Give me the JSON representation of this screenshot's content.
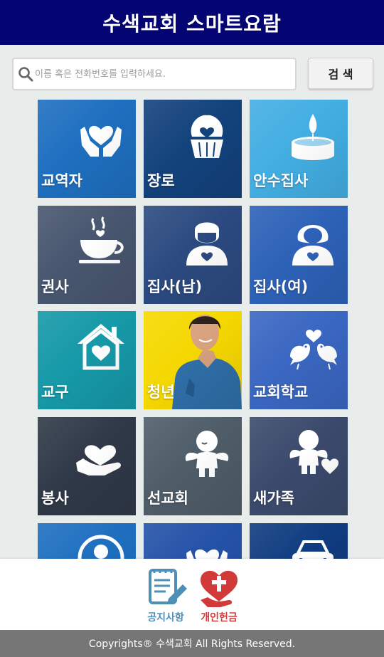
{
  "header": {
    "title": "수색교회 스마트요람"
  },
  "search": {
    "placeholder": "이름 혹은 전화번호를 입력하세요.",
    "button_label": "검 색"
  },
  "tiles": [
    {
      "label": "교역자",
      "icon": "hands-heart-icon",
      "color": "#1e6fc0"
    },
    {
      "label": "장로",
      "icon": "cupcake-heart-icon",
      "color": "#13427c"
    },
    {
      "label": "안수집사",
      "icon": "candle-icon",
      "color": "#43aee3"
    },
    {
      "label": "권사",
      "icon": "coffee-cup-icon",
      "color": "#48566f"
    },
    {
      "label": "집사(남)",
      "icon": "man-heart-icon",
      "color": "#2c4a80"
    },
    {
      "label": "집사(여)",
      "icon": "woman-heart-icon",
      "color": "#2d62b8"
    },
    {
      "label": "교구",
      "icon": "house-heart-icon",
      "color": "#1699a8"
    },
    {
      "label": "청년",
      "icon": "young-man-photo",
      "color": "#f5d800"
    },
    {
      "label": "교회학교",
      "icon": "love-birds-icon",
      "color": "#3a67c2"
    },
    {
      "label": "봉사",
      "icon": "hand-heart-icon",
      "color": "#303948"
    },
    {
      "label": "선교회",
      "icon": "cherub-icon",
      "color": "#4f5d69"
    },
    {
      "label": "새가족",
      "icon": "cherub-heart-icon",
      "color": "#3b4a6c"
    },
    {
      "label": "",
      "icon": "person-circle-icon",
      "color": "#1e6fc0"
    },
    {
      "label": "",
      "icon": "hands-heart-icon",
      "color": "#2452a8"
    },
    {
      "label": "",
      "icon": "car-icon",
      "color": "#0f3c80"
    }
  ],
  "bottom_bar": {
    "notice": {
      "label": "공지사항",
      "icon": "notepad-pencil-icon",
      "color": "#4e8fb8"
    },
    "offering": {
      "label": "개인헌금",
      "icon": "heart-cross-icon",
      "color": "#d23a3a"
    }
  },
  "footer": {
    "text": "Copyrights® 수색교회 All Rights Reserved."
  }
}
